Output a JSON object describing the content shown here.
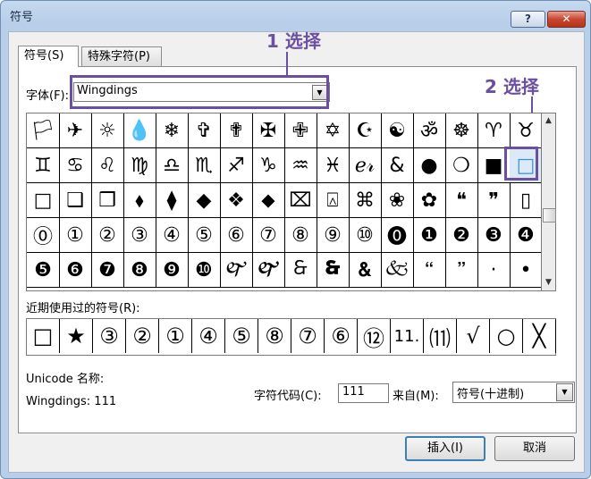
{
  "window": {
    "title": "符号",
    "help_label": "?",
    "close_label": "✕"
  },
  "tabs": [
    {
      "label": "符号(S)"
    },
    {
      "label": "特殊字符(P)"
    }
  ],
  "font": {
    "label": "字体(F):",
    "value": "Wingdings",
    "dropdown_arrow": "▼"
  },
  "annotations": {
    "step1": "1 选择",
    "step2": "2 选择",
    "accent": "#6b4fa0"
  },
  "symbol_grid": {
    "rows": [
      [
        "🏳",
        "✈",
        "☼",
        "💧",
        "❄",
        "✞",
        "✟",
        "✠",
        "✙",
        "✡",
        "☪",
        "☯",
        "ॐ",
        "☸",
        "♈",
        "♉"
      ],
      [
        "♊",
        "♋",
        "♌",
        "♍",
        "♎",
        "♏",
        "♐",
        "♑",
        "♒",
        "♓",
        "ℯ𝓇",
        "&",
        "●",
        "❍",
        "■",
        "□"
      ],
      [
        "□",
        "❑",
        "❒",
        "⬧",
        "⧫",
        "◆",
        "❖",
        "⬥",
        "⌧",
        "⍓",
        "⌘",
        "❀",
        "✿",
        "❝",
        "❞",
        "▯"
      ],
      [
        "⓪",
        "①",
        "②",
        "③",
        "④",
        "⑤",
        "⑥",
        "⑦",
        "⑧",
        "⑨",
        "⑩",
        "⓿",
        "❶",
        "❷",
        "❸",
        "❹"
      ],
      [
        "❺",
        "❻",
        "❼",
        "❽",
        "❾",
        "❿",
        "🙰",
        "🙱",
        "🙲",
        "🙳",
        "🙴",
        "🙵",
        "🙶",
        "🙷",
        "·",
        "•"
      ]
    ],
    "selected": "□",
    "scroll_up": "▲",
    "scroll_down": "▼"
  },
  "recent": {
    "label": "近期使用过的符号(R):",
    "symbols": [
      "□",
      "★",
      "③",
      "②",
      "①",
      "④",
      "⑤",
      "⑧",
      "⑦",
      "⑥",
      "⑫",
      "11.",
      "⑾",
      "√",
      "○",
      "╳"
    ]
  },
  "unicode": {
    "name_label": "Unicode 名称:",
    "name_value": "Wingdings: 111"
  },
  "char_code": {
    "label": "字符代码(C):",
    "value": "111"
  },
  "from": {
    "label": "来自(M):",
    "value": "符号(十进制)",
    "dropdown_arrow": "▼"
  },
  "buttons": {
    "insert": "插入(I)",
    "cancel": "取消"
  }
}
